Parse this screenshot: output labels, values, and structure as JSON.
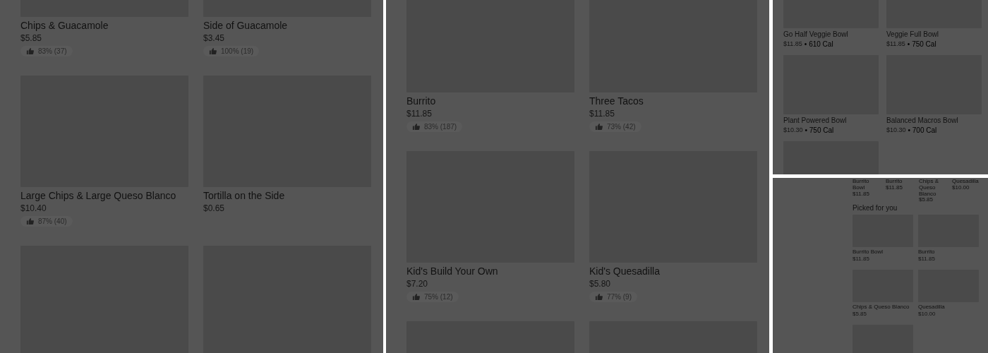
{
  "panels": [
    {
      "kind": "grid",
      "items": [
        {
          "kind": "item",
          "title": "Chips & Guacamole",
          "price": "$5.85",
          "rating": "83% (37)"
        },
        {
          "kind": "item",
          "title": "Side of Guacamole",
          "price": "$3.45",
          "rating": "100% (19)"
        },
        {
          "kind": "item",
          "title": "Large Chips & Large Queso Blanco",
          "price": "$10.40",
          "rating": "87% (40)"
        },
        {
          "kind": "item",
          "title": "Tortilla on the Side",
          "price": "$0.65"
        },
        {
          "kind": "image"
        },
        {
          "kind": "image"
        }
      ]
    },
    {
      "kind": "grid",
      "items": [
        {
          "kind": "item",
          "title": "Burrito",
          "price": "$11.85",
          "rating": "83% (187)"
        },
        {
          "kind": "item",
          "title": "Three Tacos",
          "price": "$11.85",
          "rating": "73% (42)"
        },
        {
          "kind": "item",
          "title": "Kid's Build Your Own",
          "price": "$7.20",
          "rating": "75% (12)"
        },
        {
          "kind": "item",
          "title": "Kid's Quesadilla",
          "price": "$5.80",
          "rating": "77% (9)"
        },
        {
          "kind": "image"
        },
        {
          "kind": "image"
        }
      ]
    },
    {
      "kind": "grid",
      "items": [
        {
          "kind": "item",
          "title": "Go Half Veggie Bowl",
          "price": "$11.85",
          "calories": "• 610 Cal"
        },
        {
          "kind": "item",
          "title": "Veggie Full Bowl",
          "price": "$11.85",
          "calories": "• 750 Cal"
        },
        {
          "kind": "item",
          "title": "Plant Powered Bowl",
          "price": "$10.30",
          "calories": "• 750 Cal"
        },
        {
          "kind": "item",
          "title": "Balanced Macros Bowl",
          "price": "$10.30",
          "calories": "• 700 Cal"
        },
        {
          "kind": "image"
        }
      ]
    },
    {
      "kind": "section",
      "recent": [
        {
          "title": "Burrito Bowl",
          "price": "$11.85"
        },
        {
          "title": "Burrito",
          "price": "$11.85"
        },
        {
          "title": "Chips & Queso Blanco",
          "price": "$5.85"
        },
        {
          "title": "Quesadilla",
          "price": "$10.00"
        }
      ],
      "heading": "Picked for you",
      "items": [
        {
          "kind": "item",
          "title": "Burrito Bowl",
          "price": "$11.85"
        },
        {
          "kind": "item",
          "title": "Burrito",
          "price": "$11.85"
        },
        {
          "kind": "item",
          "title": "Chips & Queso Blanco",
          "price": "$5.85"
        },
        {
          "kind": "item",
          "title": "Quesadilla",
          "price": "$10.00"
        },
        {
          "kind": "image"
        }
      ]
    }
  ]
}
